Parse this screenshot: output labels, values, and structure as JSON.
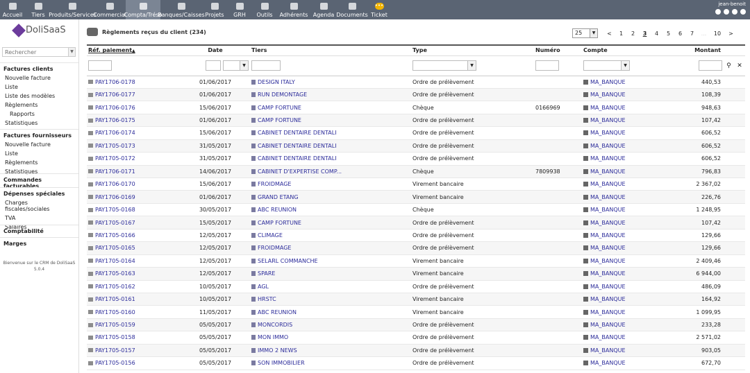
{
  "topbar": {
    "menus": [
      {
        "label": "Accueil",
        "icon": "home-icon"
      },
      {
        "label": "Tiers",
        "icon": "building-icon"
      },
      {
        "label": "Produits/Services",
        "icon": "box-icon"
      },
      {
        "label": "Commercial",
        "icon": "user-icon"
      },
      {
        "label": "Compta/Tréso",
        "icon": "coins-icon",
        "active": true
      },
      {
        "label": "Banques/Caisses",
        "icon": "bank-icon"
      },
      {
        "label": "Projets",
        "icon": "project-icon"
      },
      {
        "label": "GRH",
        "icon": "hr-icon"
      },
      {
        "label": "Outils",
        "icon": "tools-icon"
      },
      {
        "label": "Adhérents",
        "icon": "members-icon"
      },
      {
        "label": "Agenda",
        "icon": "calendar-icon"
      },
      {
        "label": "Documents",
        "icon": "folder-icon"
      },
      {
        "label": "Ticket",
        "icon": "ticket-icon"
      }
    ],
    "ticket_badge": "•••",
    "user": "jean-benoit"
  },
  "left": {
    "logo_text": "DoliSaaS",
    "search_placeholder": "Rechercher",
    "sections": [
      {
        "header": "Factures clients",
        "items": [
          "Nouvelle facture",
          "Liste",
          "Liste des modèles",
          "Règlements"
        ],
        "subitems": [
          "Rapports"
        ],
        "tail": [
          "Statistiques"
        ]
      },
      {
        "header": "Factures fournisseurs",
        "items": [
          "Nouvelle facture",
          "Liste",
          "Règlements",
          "Statistiques"
        ]
      },
      {
        "header": "Commandes facturables",
        "items": []
      },
      {
        "header": "Dépenses spéciales",
        "items": [
          "Charges fiscales/sociales",
          "TVA",
          "Salaires"
        ]
      },
      {
        "header": "Comptabilité",
        "items": []
      },
      {
        "header": "Marges",
        "items": []
      }
    ],
    "welcome_line1": "Bienvenue sur le CRM de DoliSaaS",
    "welcome_line2": "5.0.4"
  },
  "main": {
    "title": "Règlements reçus du client (234)",
    "pager": {
      "per_page": "25",
      "prev": "<",
      "pages": [
        "1",
        "2",
        "3",
        "4",
        "5",
        "6",
        "7"
      ],
      "current": "3",
      "dots": "...",
      "last": "10",
      "next": ">"
    },
    "columns": {
      "ref": "Réf. paiement",
      "sort_arrow": "▲",
      "date": "Date",
      "tiers": "Tiers",
      "type": "Type",
      "numero": "Numéro",
      "compte": "Compte",
      "montant": "Montant"
    },
    "rows": [
      {
        "ref": "PAY1706-0178",
        "date": "01/06/2017",
        "tiers": "DESIGN ITALY",
        "type": "Ordre de prélèvement",
        "numero": "",
        "compte": "MA_BANQUE",
        "montant": "440,53"
      },
      {
        "ref": "PAY1706-0177",
        "date": "01/06/2017",
        "tiers": "RUN DEMONTAGE",
        "type": "Ordre de prélèvement",
        "numero": "",
        "compte": "MA_BANQUE",
        "montant": "108,39"
      },
      {
        "ref": "PAY1706-0176",
        "date": "15/06/2017",
        "tiers": "CAMP FORTUNE",
        "type": "Chèque",
        "numero": "0166969",
        "compte": "MA_BANQUE",
        "montant": "948,63"
      },
      {
        "ref": "PAY1706-0175",
        "date": "01/06/2017",
        "tiers": "CAMP FORTUNE",
        "type": "Ordre de prélèvement",
        "numero": "",
        "compte": "MA_BANQUE",
        "montant": "107,42"
      },
      {
        "ref": "PAY1706-0174",
        "date": "15/06/2017",
        "tiers": "CABINET DENTAIRE DENTALI",
        "type": "Ordre de prélèvement",
        "numero": "",
        "compte": "MA_BANQUE",
        "montant": "606,52"
      },
      {
        "ref": "PAY1705-0173",
        "date": "31/05/2017",
        "tiers": "CABINET DENTAIRE DENTALI",
        "type": "Ordre de prélèvement",
        "numero": "",
        "compte": "MA_BANQUE",
        "montant": "606,52"
      },
      {
        "ref": "PAY1705-0172",
        "date": "31/05/2017",
        "tiers": "CABINET DENTAIRE DENTALI",
        "type": "Ordre de prélèvement",
        "numero": "",
        "compte": "MA_BANQUE",
        "montant": "606,52"
      },
      {
        "ref": "PAY1706-0171",
        "date": "14/06/2017",
        "tiers": "CABINET D'EXPERTISE COMP...",
        "type": "Chèque",
        "numero": "7809938",
        "compte": "MA_BANQUE",
        "montant": "796,83"
      },
      {
        "ref": "PAY1706-0170",
        "date": "15/06/2017",
        "tiers": "FROIDMAGE",
        "type": "Virement bancaire",
        "numero": "",
        "compte": "MA_BANQUE",
        "montant": "2 367,02"
      },
      {
        "ref": "PAY1706-0169",
        "date": "01/06/2017",
        "tiers": "GRAND ETANG",
        "type": "Virement bancaire",
        "numero": "",
        "compte": "MA_BANQUE",
        "montant": "226,76"
      },
      {
        "ref": "PAY1705-0168",
        "date": "30/05/2017",
        "tiers": "ABC REUNION",
        "type": "Chèque",
        "numero": "",
        "compte": "MA_BANQUE",
        "montant": "1 248,95"
      },
      {
        "ref": "PAY1705-0167",
        "date": "15/05/2017",
        "tiers": "CAMP FORTUNE",
        "type": "Ordre de prélèvement",
        "numero": "",
        "compte": "MA_BANQUE",
        "montant": "107,42"
      },
      {
        "ref": "PAY1705-0166",
        "date": "12/05/2017",
        "tiers": "CLIMAGE",
        "type": "Ordre de prélèvement",
        "numero": "",
        "compte": "MA_BANQUE",
        "montant": "129,66"
      },
      {
        "ref": "PAY1705-0165",
        "date": "12/05/2017",
        "tiers": "FROIDMAGE",
        "type": "Ordre de prélèvement",
        "numero": "",
        "compte": "MA_BANQUE",
        "montant": "129,66"
      },
      {
        "ref": "PAY1705-0164",
        "date": "12/05/2017",
        "tiers": "SELARL COMMANCHE",
        "type": "Virement bancaire",
        "numero": "",
        "compte": "MA_BANQUE",
        "montant": "2 409,46"
      },
      {
        "ref": "PAY1705-0163",
        "date": "12/05/2017",
        "tiers": "SPARE",
        "type": "Virement bancaire",
        "numero": "",
        "compte": "MA_BANQUE",
        "montant": "6 944,00"
      },
      {
        "ref": "PAY1705-0162",
        "date": "10/05/2017",
        "tiers": "AGL",
        "type": "Ordre de prélèvement",
        "numero": "",
        "compte": "MA_BANQUE",
        "montant": "486,09"
      },
      {
        "ref": "PAY1705-0161",
        "date": "10/05/2017",
        "tiers": "HRSTC",
        "type": "Virement bancaire",
        "numero": "",
        "compte": "MA_BANQUE",
        "montant": "164,92"
      },
      {
        "ref": "PAY1705-0160",
        "date": "11/05/2017",
        "tiers": "ABC REUNION",
        "type": "Virement bancaire",
        "numero": "",
        "compte": "MA_BANQUE",
        "montant": "1 099,95"
      },
      {
        "ref": "PAY1705-0159",
        "date": "05/05/2017",
        "tiers": "MONCORDIS",
        "type": "Ordre de prélèvement",
        "numero": "",
        "compte": "MA_BANQUE",
        "montant": "233,28"
      },
      {
        "ref": "PAY1705-0158",
        "date": "05/05/2017",
        "tiers": "MON IMMO",
        "type": "Ordre de prélèvement",
        "numero": "",
        "compte": "MA_BANQUE",
        "montant": "2 571,02"
      },
      {
        "ref": "PAY1705-0157",
        "date": "05/05/2017",
        "tiers": "IMMO 2 NEWS",
        "type": "Ordre de prélèvement",
        "numero": "",
        "compte": "MA_BANQUE",
        "montant": "903,05"
      },
      {
        "ref": "PAY1705-0156",
        "date": "05/05/2017",
        "tiers": "SON IMMOBILIER",
        "type": "Ordre de prélèvement",
        "numero": "",
        "compte": "MA_BANQUE",
        "montant": "672,70"
      }
    ]
  }
}
